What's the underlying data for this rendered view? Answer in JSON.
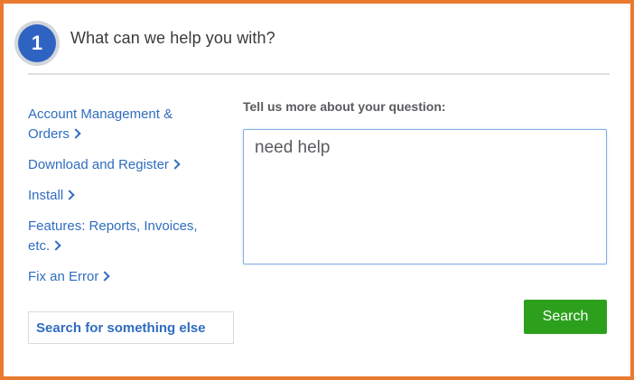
{
  "step": {
    "number": "1",
    "title": "What can we help you with?"
  },
  "topics": [
    {
      "label": "Account Management & Orders"
    },
    {
      "label": "Download and Register"
    },
    {
      "label": "Install"
    },
    {
      "label": "Features: Reports, Invoices, etc."
    },
    {
      "label": "Fix an Error"
    }
  ],
  "search_else": {
    "label": "Search for something else"
  },
  "question": {
    "label": "Tell us more about your question:",
    "value": "need help"
  },
  "search_button": {
    "label": "Search"
  },
  "colors": {
    "frame_border": "#ea7a2f",
    "badge": "#2f63c2",
    "link": "#2f6dbf",
    "primary_button": "#2ca01c"
  }
}
